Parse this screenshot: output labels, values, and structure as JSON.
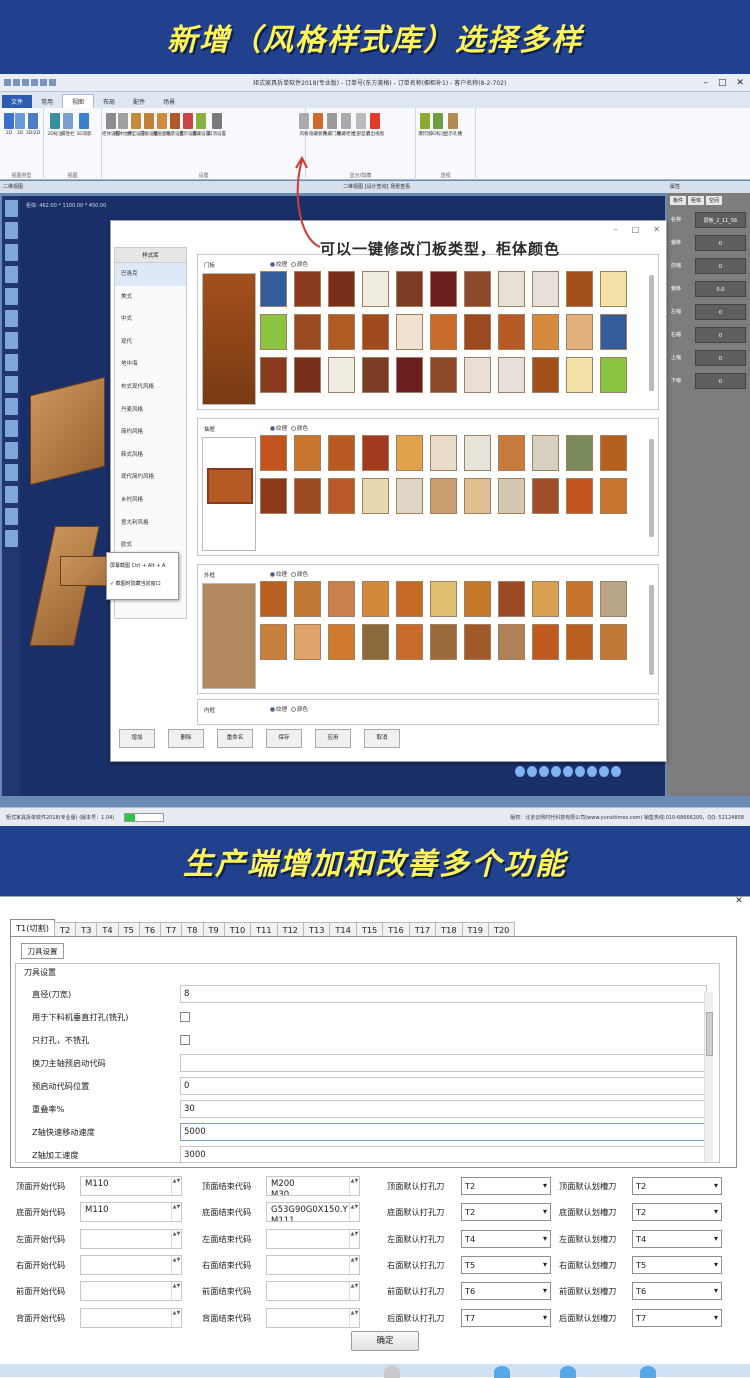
{
  "banner_top": "新增（风格样式库）选择多样",
  "banner_mid": "生产端增加和改善多个功能",
  "app": {
    "title": "矩式家具拆单软件2018(专业版) - 订单号(东方美格) - 订单名称(橱柜补1) - 客户名称(8-2-702)",
    "ribbon_tabs": [
      "文件",
      "常用",
      "视图",
      "布局",
      "配件",
      "场景"
    ],
    "active_tab": "视图",
    "ribbon_groups": [
      "视图类型",
      "视图",
      "设置",
      "显示/隐藏",
      "透视"
    ],
    "ribbon_buttons": [
      "2D",
      "3D",
      "3D/2D",
      "2D标注",
      "属性栏",
      "3D消影",
      "柜体设置",
      "柜体拉伸",
      "模型设置",
      "门板设置",
      "抽屉面板",
      "场景设置",
      "显示设置",
      "隐藏设置",
      "取消设置",
      "风格",
      "隐藏板件",
      "隐藏门板",
      "隐藏柜体",
      "全部显示",
      "退出视图",
      "爆炸图",
      "3D标注",
      "显示孔槽"
    ],
    "left_pane_title": "二维视图",
    "right_pane_title": "二维视图 [设计查询] 场景查看",
    "viewport_info": "柜体: 462.00 * 1100.00 * 450.00",
    "annotation": "可以一键修改门板类型，柜体颜色",
    "status_left": "矩式家具拆单软件2018(专业版) (版本号：1.04)",
    "status_right": "版权：北京云熙时代科技有限公司(www.yunxitimes.com)  销售热线:010-68666200，QQ: 52124858"
  },
  "style_dialog": {
    "side_header": "样式库",
    "side_items": [
      "巴洛克",
      "美式",
      "中式",
      "现代",
      "地中海",
      "布式现代风格",
      "丹麦风格",
      "简约风格",
      "韩式风格",
      "现代简约风格",
      "乡村风格",
      "意大利风格",
      "欧式"
    ],
    "selected_side": "巴洛克",
    "context_menu": [
      "屏幕截图 Ctrl + Alt + A",
      "截图时隐藏当前窗口"
    ],
    "sections": [
      {
        "label": "门板",
        "opt_a": "纹理",
        "opt_b": "颜色"
      },
      {
        "label": "抽屉",
        "opt_a": "纹理",
        "opt_b": "颜色"
      },
      {
        "label": "外框",
        "opt_a": "纹理",
        "opt_b": "颜色"
      },
      {
        "label": "内框",
        "opt_a": "纹理",
        "opt_b": "颜色"
      }
    ],
    "buttons": [
      "增加",
      "删除",
      "重命名",
      "保存",
      "应用",
      "取消"
    ]
  },
  "props_panel": {
    "title": "属性",
    "tabs": [
      "板件",
      "柜体",
      "空间"
    ],
    "rows": [
      {
        "key": "名称",
        "value": "层板_2_11_56"
      },
      {
        "key": "偏移",
        "value": "0"
      },
      {
        "key": "前缩",
        "value": "0"
      },
      {
        "key": "偏移",
        "value": "0.0"
      },
      {
        "key": "左缩",
        "value": "0"
      },
      {
        "key": "右缩",
        "value": "0"
      },
      {
        "key": "上缩",
        "value": "0"
      },
      {
        "key": "下缩",
        "value": "0"
      }
    ]
  },
  "tool_settings": {
    "tabs": [
      "T1(切割)",
      "T2",
      "T3",
      "T4",
      "T5",
      "T6",
      "T7",
      "T8",
      "T9",
      "T10",
      "T11",
      "T12",
      "T13",
      "T14",
      "T15",
      "T16",
      "T17",
      "T18",
      "T19",
      "T20"
    ],
    "active_tab": "T1(切割)",
    "subtab": "刀具设置",
    "group_title": "刀具设置",
    "fields": [
      {
        "label": "直径(刀宽)",
        "value": "8",
        "type": "text"
      },
      {
        "label": "用于下料机垂直打孔(铣孔)",
        "value": "",
        "type": "check"
      },
      {
        "label": "只打孔，不铣孔",
        "value": "",
        "type": "check"
      },
      {
        "label": "换刀主轴预启动代码",
        "value": "",
        "type": "text"
      },
      {
        "label": "预启动代码位置",
        "value": "0",
        "type": "text"
      },
      {
        "label": "重叠率%",
        "value": "30",
        "type": "text"
      },
      {
        "label": "Z轴快速移动速度",
        "value": "5000",
        "type": "text"
      },
      {
        "label": "Z轴加工速度",
        "value": "3000",
        "type": "text"
      }
    ],
    "code_rows": [
      {
        "start_label": "顶面开始代码",
        "start_value": "M110",
        "end_label": "顶面结束代码",
        "end_value": "M200\nM30",
        "drill_label": "顶面默认打孔刀",
        "drill_value": "T2",
        "slot_label": "顶面默认划槽刀",
        "slot_value": "T2"
      },
      {
        "start_label": "底面开始代码",
        "start_value": "M110",
        "end_label": "底面结束代码",
        "end_value": "G53G90G0X150.Y\nM111",
        "drill_label": "底面默认打孔刀",
        "drill_value": "T2",
        "slot_label": "底面默认划槽刀",
        "slot_value": "T2"
      },
      {
        "start_label": "左面开始代码",
        "start_value": "",
        "end_label": "左面结束代码",
        "end_value": "",
        "drill_label": "左面默认打孔刀",
        "drill_value": "T4",
        "slot_label": "左面默认划槽刀",
        "slot_value": "T4"
      },
      {
        "start_label": "右面开始代码",
        "start_value": "",
        "end_label": "右面结束代码",
        "end_value": "",
        "drill_label": "右面默认打孔刀",
        "drill_value": "T5",
        "slot_label": "右面默认划槽刀",
        "slot_value": "T5"
      },
      {
        "start_label": "前面开始代码",
        "start_value": "",
        "end_label": "前面结束代码",
        "end_value": "",
        "drill_label": "前面默认打孔刀",
        "drill_value": "T6",
        "slot_label": "前面默认划槽刀",
        "slot_value": "T6"
      },
      {
        "start_label": "背面开始代码",
        "start_value": "",
        "end_label": "背面结束代码",
        "end_value": "",
        "drill_label": "后面默认打孔刀",
        "drill_value": "T7",
        "slot_label": "后面默认划槽刀",
        "slot_value": "T7"
      }
    ],
    "ok_label": "确定"
  },
  "colors": {
    "banner_bg": "#21418f",
    "banner_text": "#fff45a",
    "viewport": "#1a2f68",
    "ribbon_active": "#2c5bb3"
  }
}
